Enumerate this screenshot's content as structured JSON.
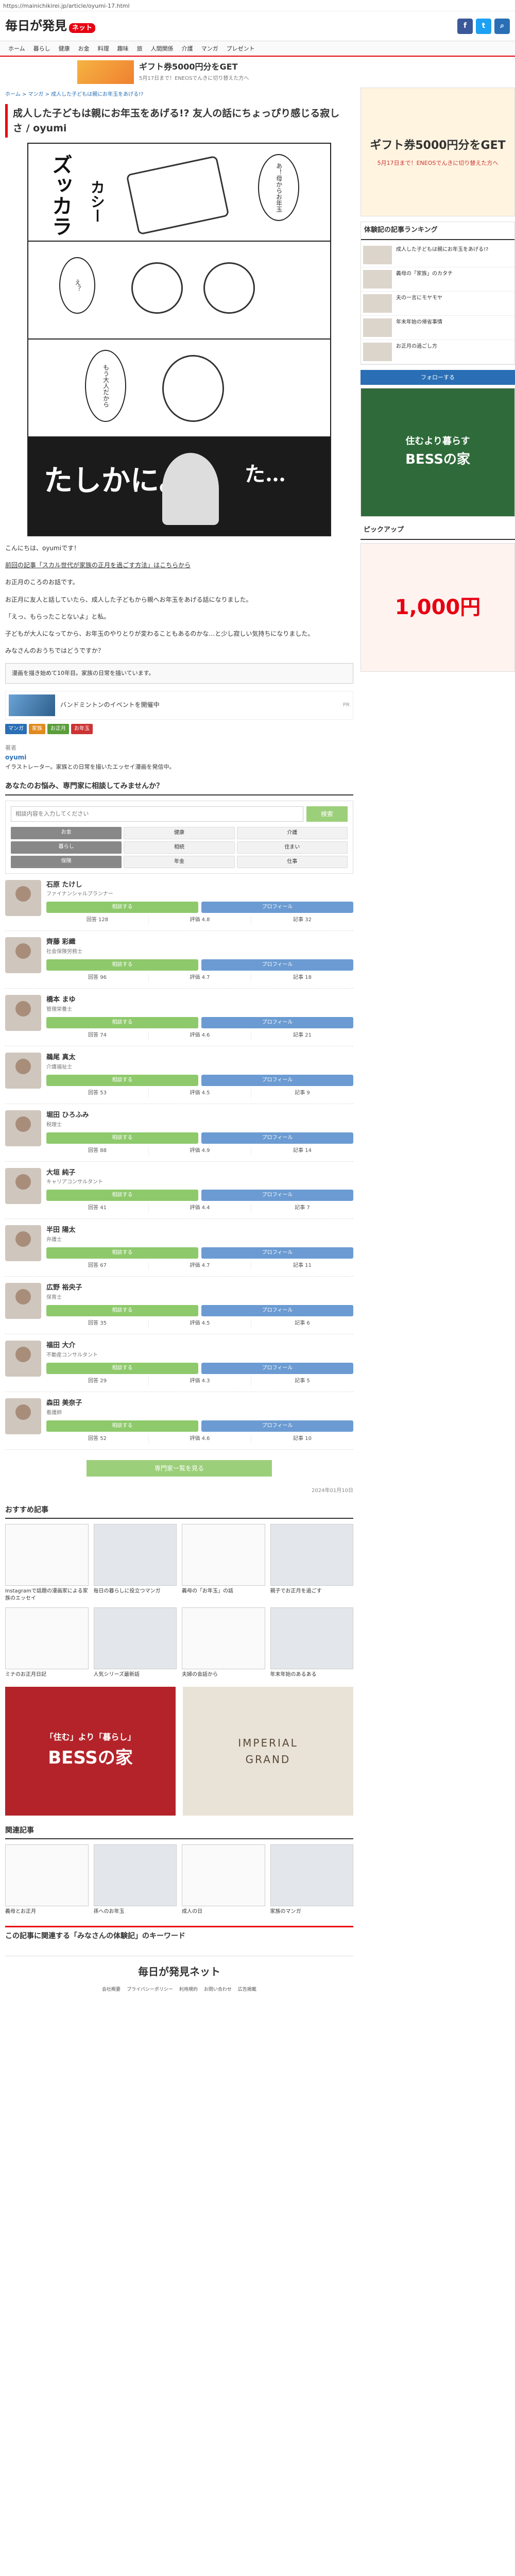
{
  "url": "https://mainichikirei.jp/article/oyumi-17.html",
  "header": {
    "logo": "毎日が発見",
    "logo_badge": "ネット"
  },
  "gnav": [
    "ホーム",
    "暮らし",
    "健康",
    "お金",
    "料理",
    "趣味",
    "旅",
    "人間関係",
    "介護",
    "マンガ",
    "プレゼント"
  ],
  "top_ad": {
    "title": "ギフト券5000円分をGET",
    "desc": "5月17日まで！ENEOSでんきに切り替えた方へ"
  },
  "breadcrumb": "ホーム > マンガ > 成人した子どもは親にお年玉をあげる!?",
  "article": {
    "title": "成人した子どもは親にお年玉をあげる!? 友人の話にちょっぴり感じる寂しさ / oyumi",
    "panel1_sfx": "ズッカラ",
    "panel1_sfx2": "カシー",
    "panel1_bubble": "あ！母からお年玉",
    "panel2_bubble": "え？",
    "panel3_bubble": "もう大人だから",
    "panel4_sfx": "たしかに。",
    "panel4_sfx2": "た…",
    "credit": "こんにちは、oyumiです！",
    "lead_link": "前回の記事「スカル世代が家族の正月を過ごす方法」はこちらから",
    "paragraphs": [
      "お正月のころのお話です。",
      "お正月に友人と話していたら、成人した子どもから親へお年玉をあげる話になりました。",
      "「えっ、もらったことないよ」と私。",
      "子どもが大人になってから、お年玉のやりとりが変わることもあるのかな…と少し寂しい気持ちになりました。",
      "みなさんのおうちではどうですか？"
    ],
    "note_box": "漫画を描き始めて10年目。家族の日常を描いています。",
    "ad_text": "バンドミントンのイベントを開催中",
    "ad_sponsor": "PR",
    "tags": [
      "マンガ",
      "家族",
      "お正月",
      "お年玉"
    ],
    "author_label": "著者",
    "author_name": "oyumi",
    "author_desc": "イラストレーター。家族との日常を描いたエッセイ漫画を発信中。"
  },
  "expert_section": {
    "title": "あなたのお悩み、専門家に相談してみませんか？",
    "search_placeholder": "相談内容を入力してください",
    "search_button": "検索",
    "filters": [
      "お金",
      "健康",
      "介護",
      "暮らし",
      "相続",
      "住まい",
      "保険",
      "年金",
      "仕事"
    ],
    "experts": [
      {
        "name": "石原 たけし",
        "title": "ファイナンシャルプランナー",
        "btn1": "相談する",
        "btn2": "プロフィール",
        "s1": "回答 128",
        "s2": "評価 4.8",
        "s3": "記事 32"
      },
      {
        "name": "齊藤 彩織",
        "title": "社会保険労務士",
        "btn1": "相談する",
        "btn2": "プロフィール",
        "s1": "回答 96",
        "s2": "評価 4.7",
        "s3": "記事 18"
      },
      {
        "name": "橋本 まゆ",
        "title": "管理栄養士",
        "btn1": "相談する",
        "btn2": "プロフィール",
        "s1": "回答 74",
        "s2": "評価 4.6",
        "s3": "記事 21"
      },
      {
        "name": "鵜尾 真太",
        "title": "介護福祉士",
        "btn1": "相談する",
        "btn2": "プロフィール",
        "s1": "回答 53",
        "s2": "評価 4.5",
        "s3": "記事 9"
      },
      {
        "name": "堀田 ひろふみ",
        "title": "税理士",
        "btn1": "相談する",
        "btn2": "プロフィール",
        "s1": "回答 88",
        "s2": "評価 4.9",
        "s3": "記事 14"
      },
      {
        "name": "大垣 純子",
        "title": "キャリアコンサルタント",
        "btn1": "相談する",
        "btn2": "プロフィール",
        "s1": "回答 41",
        "s2": "評価 4.4",
        "s3": "記事 7"
      },
      {
        "name": "半田 陽太",
        "title": "弁護士",
        "btn1": "相談する",
        "btn2": "プロフィール",
        "s1": "回答 67",
        "s2": "評価 4.7",
        "s3": "記事 11"
      },
      {
        "name": "広野 裕央子",
        "title": "保育士",
        "btn1": "相談する",
        "btn2": "プロフィール",
        "s1": "回答 35",
        "s2": "評価 4.5",
        "s3": "記事 6"
      },
      {
        "name": "福田 大介",
        "title": "不動産コンサルタント",
        "btn1": "相談する",
        "btn2": "プロフィール",
        "s1": "回答 29",
        "s2": "評価 4.3",
        "s3": "記事 5"
      },
      {
        "name": "森田 美奈子",
        "title": "看護師",
        "btn1": "相談する",
        "btn2": "プロフィール",
        "s1": "回答 52",
        "s2": "評価 4.6",
        "s3": "記事 10"
      }
    ],
    "more_button": "専門家一覧を見る"
  },
  "date": "2024年01月10日",
  "recommend": {
    "title": "おすすめ記事",
    "cards": [
      "Instagramで話題の漫画家による家族のエッセイ",
      "毎日の暮らしに役立つマンガ",
      "義母の「お年玉」の話",
      "親子でお正月を過ごす",
      "ミナのお正月日記",
      "人気シリーズ最新話",
      "夫婦の会話から",
      "年末年始のあるある"
    ]
  },
  "big_ads": [
    {
      "line1": "「住む」より「暮らし」",
      "line2": "BESSの家"
    },
    {
      "line1": "IMPERIAL",
      "line2": "GRAND"
    }
  ],
  "related": {
    "title": "関連記事",
    "cards": [
      "義母とお正月",
      "孫へのお年玉",
      "成人の日",
      "家族のマンガ"
    ]
  },
  "keyword_title": "この記事に関連する「みなさんの体験記」のキーワード",
  "footer": {
    "logo": "毎日が発見ネット",
    "links": [
      "会社概要",
      "プライバシーポリシー",
      "利用規約",
      "お問い合わせ",
      "広告掲載"
    ]
  },
  "side": {
    "ad1_title": "ギフト券5000円分をGET",
    "ad1_desc": "5月17日まで！ENEOSでんきに切り替えた方へ",
    "ranking_title": "体験記の記事ランキング",
    "ranking": [
      "成人した子どもは親にお年玉をあげる!?",
      "義母の「家族」のカタチ",
      "夫の一言にモヤモヤ",
      "年末年始の帰省事情",
      "お正月の過ごし方"
    ],
    "follow": "フォローする",
    "ad2_line1": "住むより暮らす",
    "ad2_line2": "BESSの家",
    "pickup_title": "ピックアップ",
    "pickup_price": "1,000円"
  }
}
